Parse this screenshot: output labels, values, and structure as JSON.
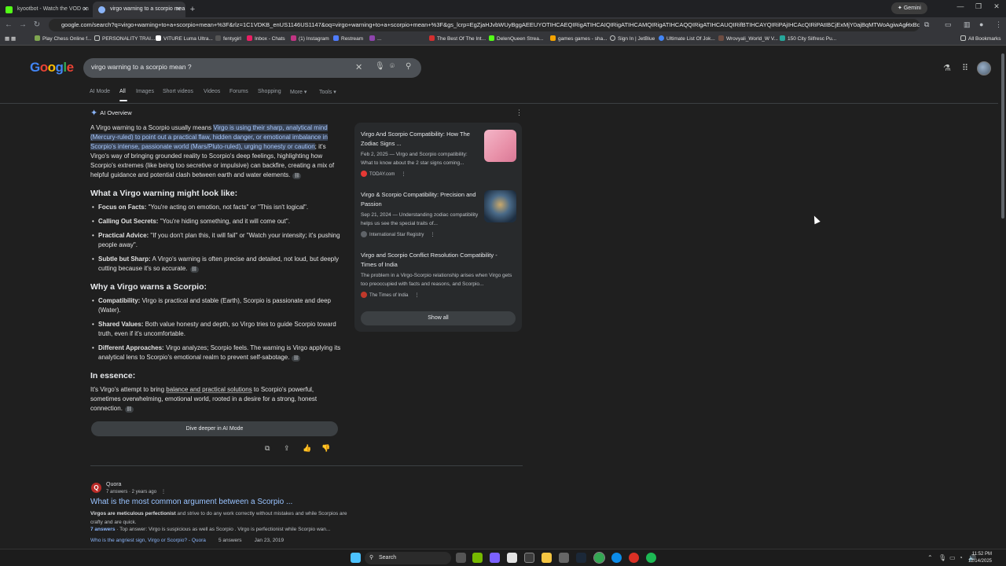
{
  "browser": {
    "tabs": [
      {
        "title": "kyootbot - Watch the VOD on",
        "active": false
      },
      {
        "title": "virgo warning to a scorpio mea",
        "active": true
      }
    ],
    "gemini_label": "Gemini",
    "url": "google.com/search?q=virgo+warning+to+a+scorpio+mean+%3F&rlz=1C1VDKB_enUS1146US1147&oq=virgo+warning+to+a+scorpio+mean+%3F&gs_lcrp=EgZjaHJvbWUyBggAEEUYOTIHCAEQIRigATIHCAIQIRigATIHCAMQIRigATIHCAQQIRigATIHCAUQIRifBTIHCAYQIRiPAjIHCAcQIRiPAtIBCjExMjY0ajBqMTWoAgiwAgHxBce4Sh5HUakg8QXHxE...",
    "bookmarks": [
      "Play Chess Online f...",
      "PERSONALITY TRAI...",
      "VITURE Luma Ultra...",
      "fentygirl",
      "Inbox - Chats",
      "(1) Instagram",
      "Restream",
      "...",
      "The Best Of The Int...",
      "DelenQueen Strea...",
      "games games - sha...",
      "Sign In | JetBlue",
      "Ultimate List Of Jok...",
      "Wrovyali_World_W V...",
      "150 City Silfresc Pu..."
    ],
    "all_bookmarks": "All Bookmarks"
  },
  "google": {
    "logo": "Google",
    "query": "virgo warning to a scorpio mean ?",
    "nav_tabs": [
      "AI Mode",
      "All",
      "Images",
      "Short videos",
      "Videos",
      "Forums",
      "Shopping",
      "More ▾",
      "Tools ▾"
    ],
    "ai_overview": {
      "label": "AI Overview",
      "intro_pre": "A Virgo warning to a Scorpio usually means ",
      "intro_hl": "Virgo is using their sharp, analytical mind (Mercury-ruled) to point out a practical flaw, hidden danger, or emotional imbalance in Scorpio's intense, passionate world (Mars/Pluto-ruled), urging honesty or caution",
      "intro_post": "; it's Virgo's way of bringing grounded reality to Scorpio's deep feelings, highlighting how Scorpio's extremes (like being too secretive or impulsive) can backfire, creating a mix of helpful guidance and potential clash between earth and water elements.",
      "h1": "What a Virgo warning might look like:",
      "list1": [
        {
          "b": "Focus on Facts:",
          "t": " \"You're acting on emotion, not facts\" or \"This isn't logical\"."
        },
        {
          "b": "Calling Out Secrets:",
          "t": " \"You're hiding something, and it will come out\"."
        },
        {
          "b": "Practical Advice:",
          "t": " \"If you don't plan this, it will fail\" or \"Watch your intensity; it's pushing people away\"."
        },
        {
          "b": "Subtle but Sharp:",
          "t": " A Virgo's warning is often precise and detailed, not loud, but deeply cutting because it's so accurate."
        }
      ],
      "h2": "Why a Virgo warns a Scorpio:",
      "list2": [
        {
          "b": "Compatibility:",
          "t": " Virgo is practical and stable (Earth), Scorpio is passionate and deep (Water)."
        },
        {
          "b": "Shared Values:",
          "t": " Both value honesty and depth, so Virgo tries to guide Scorpio toward truth, even if it's uncomfortable."
        },
        {
          "b": "Different Approaches:",
          "t": " Virgo analyzes; Scorpio feels. The warning is Virgo applying its analytical lens to Scorpio's emotional realm to prevent self-sabotage."
        }
      ],
      "h3": "In essence:",
      "essence_pre": "It's Virgo's attempt to bring ",
      "essence_u": "balance and practical solutions",
      "essence_post": " to Scorpio's powerful, sometimes overwhelming, emotional world, rooted in a desire for a strong, honest connection.",
      "dive_deeper": "Dive deeper in AI Mode"
    },
    "sources": [
      {
        "title": "Virgo And Scorpio Compatibility: How The Zodiac Signs ...",
        "snippet": "Feb 2, 2025 — Virgo and Scorpio compatibility: What to know about the 2 star signs coming...",
        "source": "TODAY.com",
        "color": "#e8a0b8"
      },
      {
        "title": "Virgo & Scorpio Compatibility: Precision and Passion",
        "snippet": "Sep 21, 2024 — Understanding zodiac compatibility helps us see the special traits of...",
        "source": "International Star Registry",
        "color": "#3a5a78"
      },
      {
        "title": "Virgo and Scorpio Conflict Resolution Compatibility - Times of India",
        "snippet": "The problem in a Virgo-Scorpio relationship arises when Virgo gets too preoccupied with facts and reasons, and Scorpio...",
        "source": "The Times of India",
        "color": "#c0392b"
      }
    ],
    "show_all": "Show all",
    "result": {
      "site": "Quora",
      "meta": "7 answers · 2 years ago",
      "title": "What is the most common argument between a Scorpio ...",
      "snippet_b": "Virgos are meticulous perfectionist",
      "snippet": " and strive to do any work correctly without mistakes and while Scorpios are crafty and are quick.",
      "answers_link": "7 answers",
      "answers_text": " · Top answer: Virgo is suspicious as well as Scorpio . Virgo is perfectionist while Scorpio wan...",
      "related_q": "Who is the angriest sign, Virgo or Scorpio? - Quora",
      "related_answers": "5 answers",
      "related_date": "Jan 23, 2019"
    }
  },
  "taskbar": {
    "search": "Search",
    "time": "11:52 PM",
    "date": "12/14/2025"
  }
}
